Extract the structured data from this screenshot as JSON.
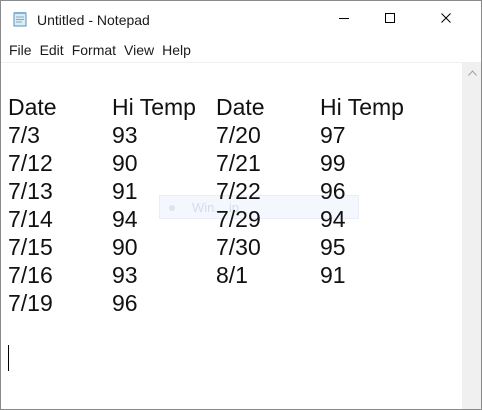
{
  "window": {
    "title": "Untitled - Notepad"
  },
  "icons": {
    "app": "notepad-icon",
    "minimize": "minimize-icon",
    "maximize": "maximize-icon",
    "close": "close-icon",
    "scroll_up": "chevron-up-icon"
  },
  "menu": [
    "File",
    "Edit",
    "Format",
    "View",
    "Help"
  ],
  "document": {
    "headers": [
      "Date",
      "Hi Temp",
      "Date",
      "Hi Temp"
    ],
    "rows": [
      [
        "7/3",
        "93",
        "7/20",
        "97"
      ],
      [
        "7/12",
        "90",
        "7/21",
        "99"
      ],
      [
        "7/13",
        "91",
        "7/22",
        "96"
      ],
      [
        "7/14",
        "94",
        "7/29",
        "94"
      ],
      [
        "7/15",
        "90",
        "7/30",
        "95"
      ],
      [
        "7/16",
        "93",
        "8/1",
        "91"
      ],
      [
        "7/19",
        "96",
        "",
        ""
      ]
    ]
  },
  "tooltip": {
    "text": "Win... ip"
  }
}
